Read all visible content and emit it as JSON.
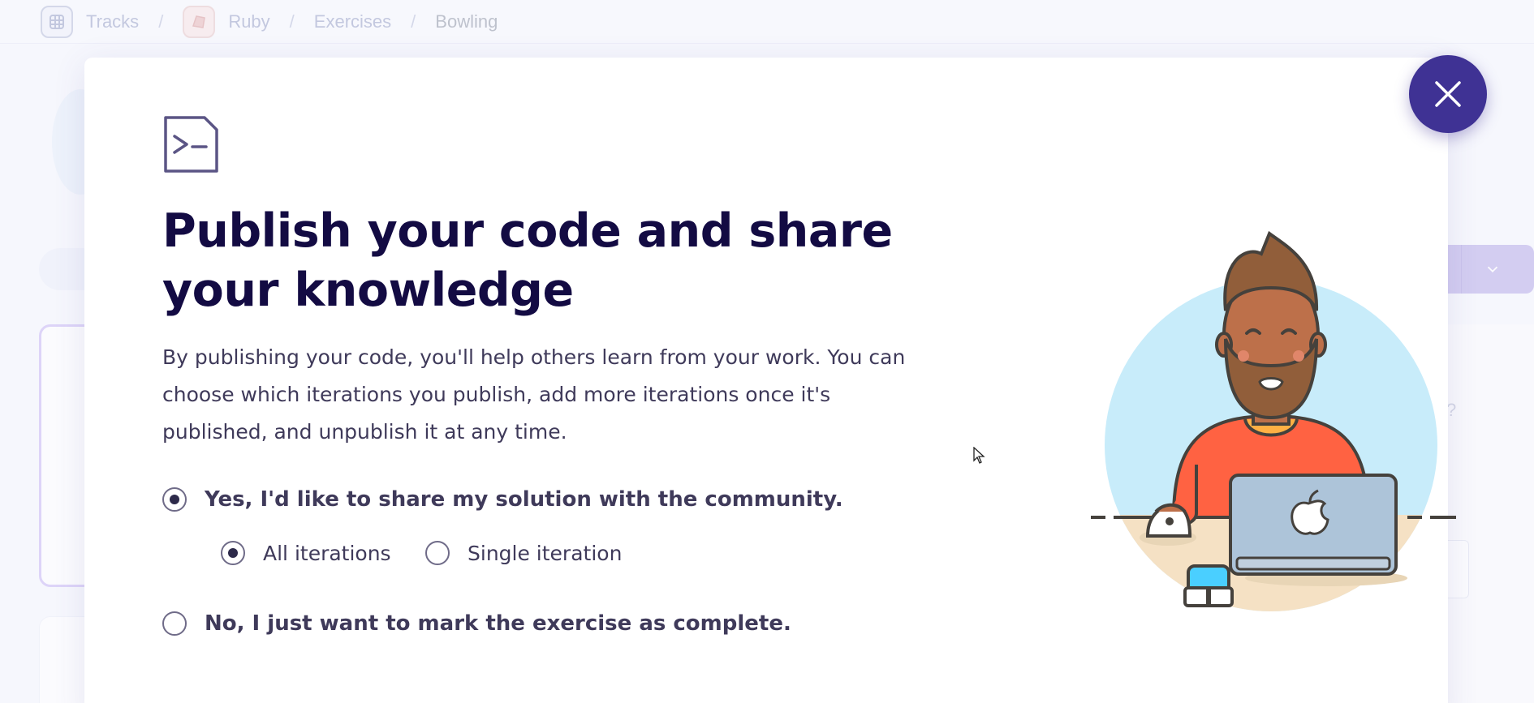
{
  "breadcrumb": {
    "items": [
      {
        "label": "Tracks",
        "icon": "tracks-icon"
      },
      {
        "label": "Ruby",
        "icon": "ruby-icon"
      },
      {
        "label": "Exercises"
      },
      {
        "label": "Bowling"
      }
    ],
    "separator": "/"
  },
  "background": {
    "help_mark": "?"
  },
  "modal": {
    "icon": "terminal-icon",
    "title": "Publish your code and share your knowledge",
    "description": "By publishing your code, you'll help others learn from your work. You can choose which iterations you publish, add more iterations once it's published, and unpublish it at any time.",
    "options": {
      "yes": {
        "label": "Yes, I'd like to share my solution with the community.",
        "checked": true
      },
      "all_iterations": {
        "label": "All iterations",
        "checked": true
      },
      "single_iteration": {
        "label": "Single iteration",
        "checked": false
      },
      "no": {
        "label": "No, I just want to mark the exercise as complete.",
        "checked": false
      }
    },
    "illustration": "developer-with-laptop-illustration",
    "close": "close-icon"
  },
  "colors": {
    "accent": "#3f3294",
    "title": "#130b43",
    "body_text": "#3f3a5a",
    "illustration_bg": "#c8ecfa"
  }
}
